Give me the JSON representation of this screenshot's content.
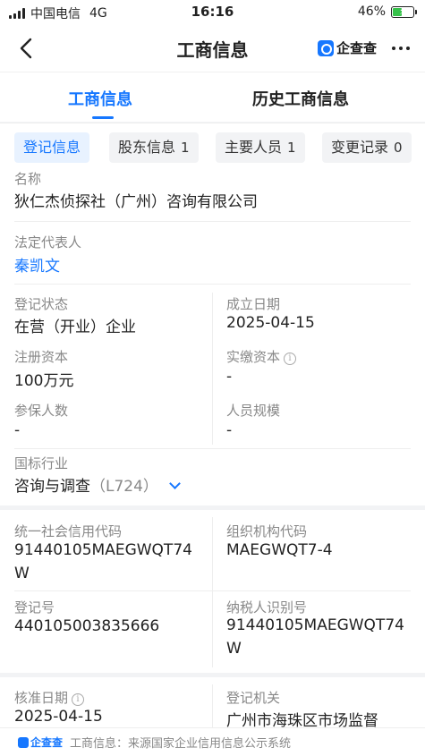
{
  "status_bar": {
    "carrier": "中国电信",
    "network": "4G",
    "time": "16:16",
    "battery_pct": "46%",
    "battery_level": 0.46
  },
  "nav": {
    "title": "工商信息",
    "brand": "企查查"
  },
  "tabs": [
    "工商信息",
    "历史工商信息"
  ],
  "subtabs": [
    {
      "label": "登记信息",
      "count": ""
    },
    {
      "label": "股东信息",
      "count": "1"
    },
    {
      "label": "主要人员",
      "count": "1"
    },
    {
      "label": "变更记录",
      "count": "0"
    }
  ],
  "info": {
    "name_label": "名称",
    "name_value": "狄仁杰侦探社（广州）咨询有限公司",
    "legal_rep_label": "法定代表人",
    "legal_rep_value": "秦凯文",
    "reg_status_label": "登记状态",
    "reg_status_value": "在营（开业）企业",
    "founded_label": "成立日期",
    "founded_value": "2025-04-15",
    "reg_capital_label": "注册资本",
    "reg_capital_value": "100万元",
    "paid_capital_label": "实缴资本",
    "paid_capital_value": "-",
    "insured_label": "参保人数",
    "insured_value": "-",
    "staff_size_label": "人员规模",
    "staff_size_value": "-",
    "industry_label": "国标行业",
    "industry_value": "咨询与调查",
    "industry_code": "（L724）"
  },
  "codes": {
    "credit_code_label": "统一社会信用代码",
    "credit_code_value": "91440105MAEGWQT74W",
    "org_code_label": "组织机构代码",
    "org_code_value": "MAEGWQT7-4",
    "reg_no_label": "登记号",
    "reg_no_value": "440105003835666",
    "taxpayer_id_label": "纳税人识别号",
    "taxpayer_id_value": "91440105MAEGWQT74W"
  },
  "approval": {
    "approve_date_label": "核准日期",
    "approve_date_value": "2025-04-15",
    "authority_label": "登记机关",
    "authority_value": "广州市海珠区市场监督"
  },
  "footer": {
    "logo_text": "企查查",
    "source_text": "工商信息：来源国家企业信用信息公示系统"
  },
  "colors": {
    "accent": "#1677ff",
    "battery": "#36c24a"
  }
}
